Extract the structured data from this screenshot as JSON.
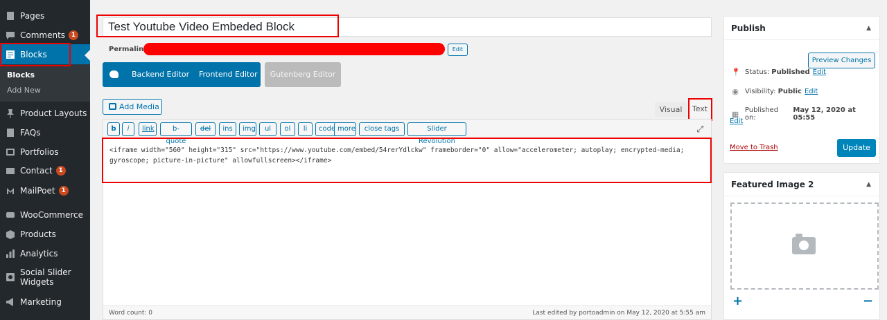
{
  "sidebar": {
    "items": [
      {
        "label": "Pages",
        "icon": "pages-icon"
      },
      {
        "label": "Comments",
        "icon": "comments-icon",
        "badge": "1"
      },
      {
        "label": "Blocks",
        "icon": "blocks-icon"
      },
      {
        "label": "Product Layouts",
        "icon": "pin-icon"
      },
      {
        "label": "FAQs",
        "icon": "faqs-icon"
      },
      {
        "label": "Portfolios",
        "icon": "portfolio-icon"
      },
      {
        "label": "Contact",
        "icon": "mail-icon",
        "badge": "1"
      },
      {
        "label": "MailPoet",
        "icon": "mailpoet-icon",
        "badge": "1"
      },
      {
        "label": "WooCommerce",
        "icon": "woocommerce-icon"
      },
      {
        "label": "Products",
        "icon": "products-icon"
      },
      {
        "label": "Analytics",
        "icon": "chart-bar-icon"
      },
      {
        "label": "Social Slider\nWidgets",
        "icon": "instagram-icon"
      },
      {
        "label": "Marketing",
        "icon": "megaphone-icon"
      }
    ],
    "submenu": [
      "Blocks",
      "Add New"
    ],
    "active_color": "#0073aa"
  },
  "editor": {
    "title": "Test Youtube Video Embeded Block",
    "permalink_label": "Permalink:",
    "permalink_edit": "Edit",
    "backend_editor": "Backend Editor",
    "frontend_editor": "Frontend Editor",
    "gutenberg_editor": "Gutenberg Editor",
    "add_media": "Add Media",
    "tab_visual": "Visual",
    "tab_text": "Text",
    "quicktags": [
      "b",
      "i",
      "link",
      "b-quote",
      "del",
      "ins",
      "img",
      "ul",
      "ol",
      "li",
      "code",
      "more",
      "close tags",
      "Slider Revolution"
    ],
    "content": "<iframe width=\"560\" height=\"315\" src=\"https://www.youtube.com/embed/54rerYdlckw\" frameborder=\"0\" allow=\"accelerometer; autoplay; encrypted-media; gyroscope; picture-in-picture\" allowfullscreen></iframe>",
    "word_count": "Word count: 0",
    "last_edited": "Last edited by portoadmin on May 12, 2020 at 5:55 am"
  },
  "publish": {
    "title": "Publish",
    "preview": "Preview Changes",
    "status_label": "Status:",
    "status_value": "Published",
    "visibility_label": "Visibility:",
    "visibility_value": "Public",
    "published_label": "Published on:",
    "published_value": "May 12, 2020 at 05:55",
    "edit": "Edit",
    "trash": "Move to Trash",
    "update": "Update"
  },
  "featured_image": {
    "title": "Featured Image 2",
    "add": "+",
    "remove": "−"
  }
}
